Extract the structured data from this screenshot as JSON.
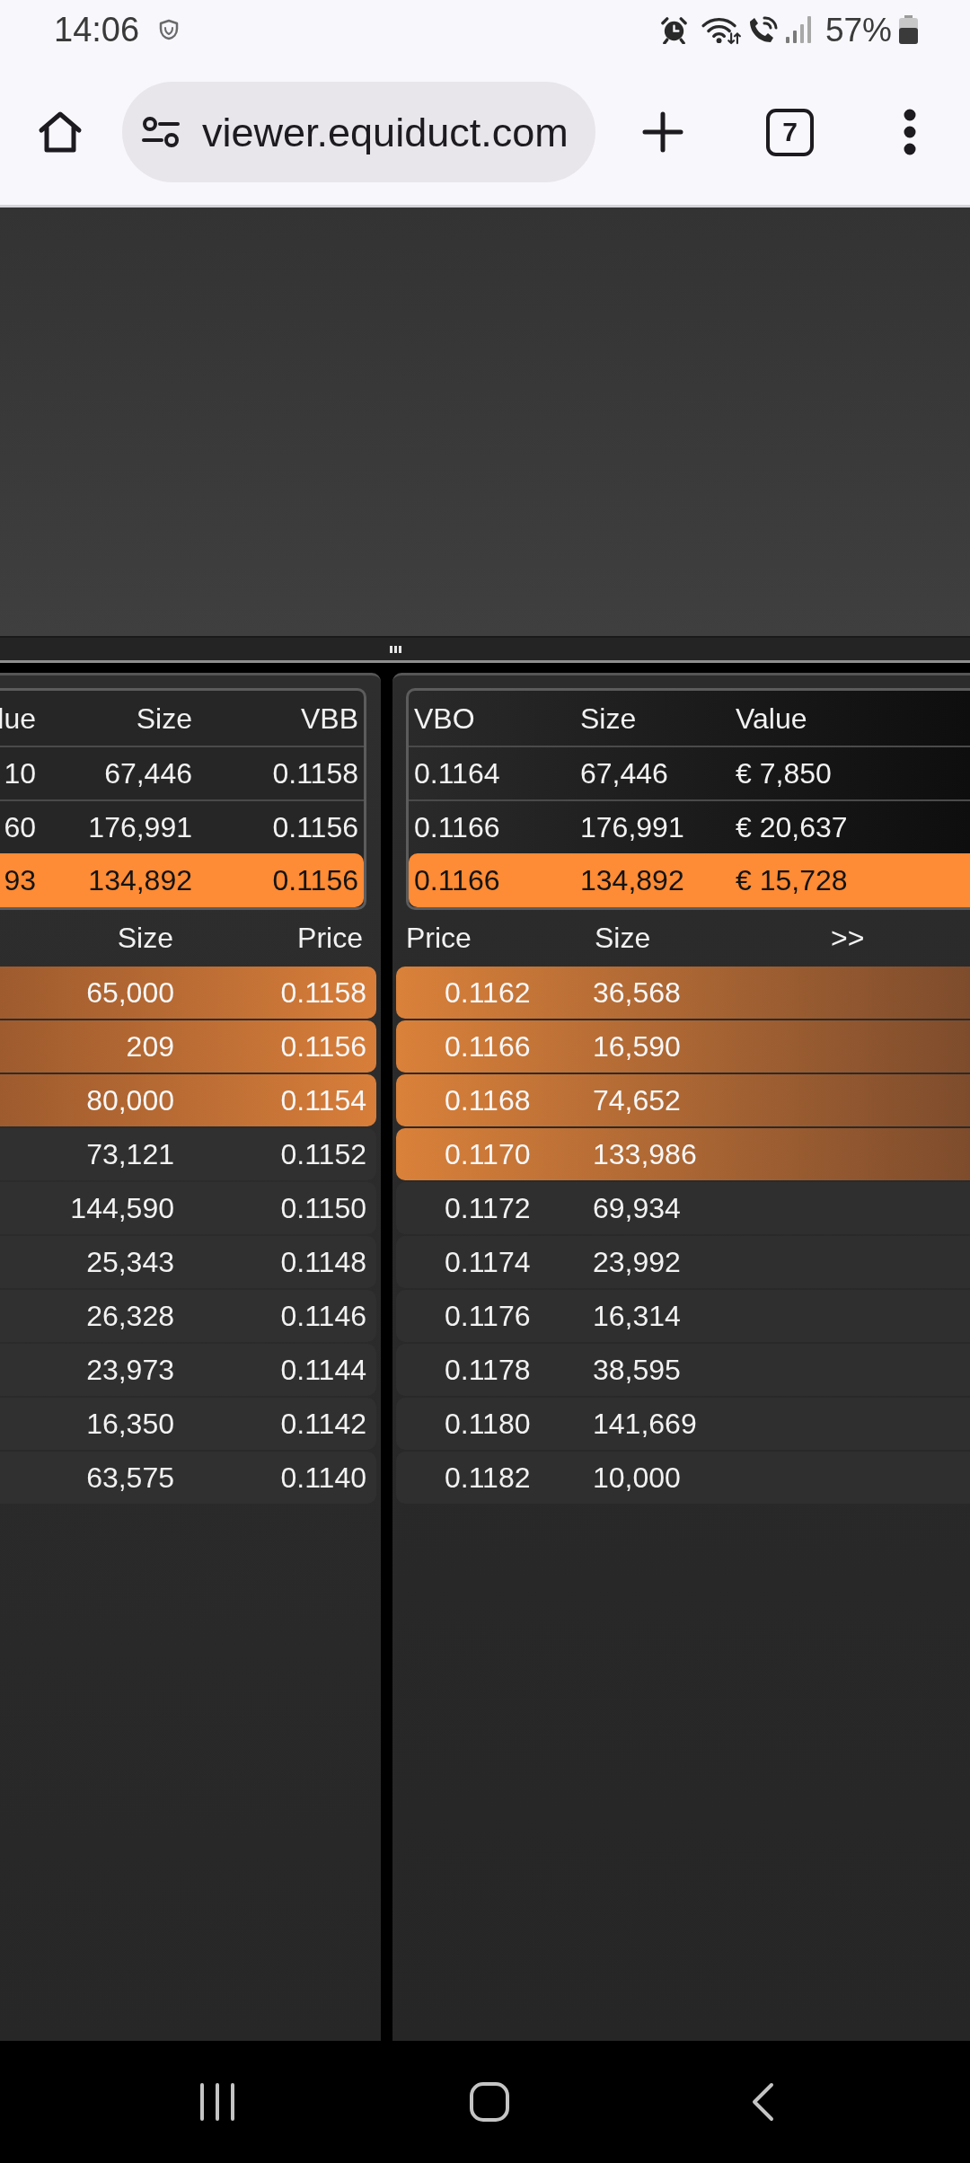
{
  "status_bar": {
    "time": "14:06",
    "battery": "57%"
  },
  "browser": {
    "url": "viewer.equiduct.com",
    "tab_count": "7"
  },
  "bid_summary": {
    "columns": [
      "lue",
      "Size",
      "VBB"
    ],
    "rows": [
      {
        "cells": [
          "10",
          "67,446",
          "0.1158"
        ],
        "highlighted": false
      },
      {
        "cells": [
          "60",
          "176,991",
          "0.1156"
        ],
        "highlighted": false
      },
      {
        "cells": [
          "93",
          "134,892",
          "0.1156"
        ],
        "highlighted": true
      }
    ]
  },
  "offer_summary": {
    "columns": [
      "VBO",
      "Size",
      "Value"
    ],
    "rows": [
      {
        "cells": [
          "0.1164",
          "67,446",
          "€ 7,850"
        ],
        "highlighted": false
      },
      {
        "cells": [
          "0.1166",
          "176,991",
          "€ 20,637"
        ],
        "highlighted": false
      },
      {
        "cells": [
          "0.1166",
          "134,892",
          "€ 15,728"
        ],
        "highlighted": true
      }
    ]
  },
  "bids": {
    "columns": [
      "Size",
      "Price"
    ],
    "rows": [
      {
        "size": "65,000",
        "price": "0.1158",
        "highlighted": true
      },
      {
        "size": "209",
        "price": "0.1156",
        "highlighted": true
      },
      {
        "size": "80,000",
        "price": "0.1154",
        "highlighted": true
      },
      {
        "size": "73,121",
        "price": "0.1152",
        "highlighted": false
      },
      {
        "size": "144,590",
        "price": "0.1150",
        "highlighted": false
      },
      {
        "size": "25,343",
        "price": "0.1148",
        "highlighted": false
      },
      {
        "size": "26,328",
        "price": "0.1146",
        "highlighted": false
      },
      {
        "size": "23,973",
        "price": "0.1144",
        "highlighted": false
      },
      {
        "size": "16,350",
        "price": "0.1142",
        "highlighted": false
      },
      {
        "size": "63,575",
        "price": "0.1140",
        "highlighted": false
      }
    ]
  },
  "offers": {
    "columns": [
      "Price",
      "Size"
    ],
    "more": ">>",
    "rows": [
      {
        "price": "0.1162",
        "size": "36,568",
        "highlighted": true
      },
      {
        "price": "0.1166",
        "size": "16,590",
        "highlighted": true
      },
      {
        "price": "0.1168",
        "size": "74,652",
        "highlighted": true
      },
      {
        "price": "0.1170",
        "size": "133,986",
        "highlighted": true
      },
      {
        "price": "0.1172",
        "size": "69,934",
        "highlighted": false
      },
      {
        "price": "0.1174",
        "size": "23,992",
        "highlighted": false
      },
      {
        "price": "0.1176",
        "size": "16,314",
        "highlighted": false
      },
      {
        "price": "0.1178",
        "size": "38,595",
        "highlighted": false
      },
      {
        "price": "0.1180",
        "size": "141,669",
        "highlighted": false
      },
      {
        "price": "0.1182",
        "size": "10,000",
        "highlighted": false
      }
    ]
  }
}
